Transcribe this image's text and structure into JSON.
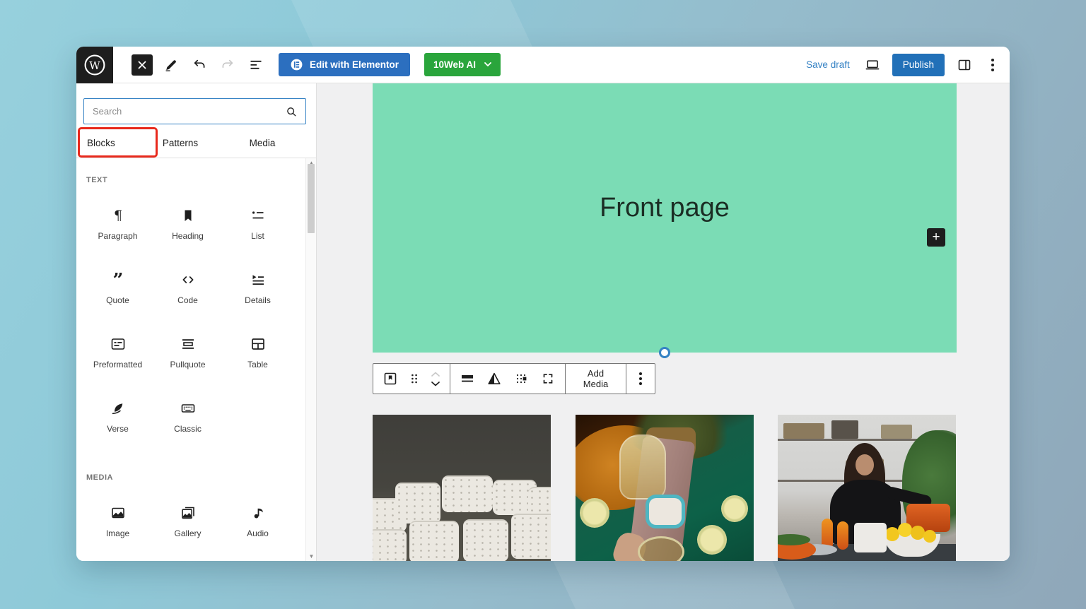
{
  "colors": {
    "cover_green": "#7bdcb5",
    "publish_blue": "#2170b8",
    "elementor_blue": "#2c6fbf",
    "tenweb_green": "#2aa53c",
    "annotation_red": "#e8291c",
    "canvas_gray": "#f0f0f1",
    "save_draft_blue": "#3582c4"
  },
  "header": {
    "edit_with_elementor_label": "Edit with Elementor",
    "tenweb_ai_label": "10Web AI",
    "save_draft_label": "Save draft",
    "publish_label": "Publish",
    "icons": [
      "wordpress-logo",
      "close-icon",
      "pencil-icon",
      "undo-icon",
      "redo-icon",
      "list-view-icon",
      "laptop-preview-icon",
      "settings-panel-icon",
      "kebab-menu-icon"
    ]
  },
  "inserter": {
    "search_placeholder": "Search",
    "tabs": [
      {
        "label": "Blocks",
        "highlighted": true
      },
      {
        "label": "Patterns",
        "highlighted": false
      },
      {
        "label": "Media",
        "highlighted": false
      }
    ],
    "sections": [
      {
        "title": "TEXT",
        "items": [
          {
            "label": "Paragraph",
            "icon": "paragraph-icon"
          },
          {
            "label": "Heading",
            "icon": "heading-icon"
          },
          {
            "label": "List",
            "icon": "list-icon"
          },
          {
            "label": "Quote",
            "icon": "quote-icon"
          },
          {
            "label": "Code",
            "icon": "code-icon"
          },
          {
            "label": "Details",
            "icon": "details-icon"
          },
          {
            "label": "Preformatted",
            "icon": "preformatted-icon"
          },
          {
            "label": "Pullquote",
            "icon": "pullquote-icon"
          },
          {
            "label": "Table",
            "icon": "table-icon"
          },
          {
            "label": "Verse",
            "icon": "verse-icon"
          },
          {
            "label": "Classic",
            "icon": "classic-icon"
          }
        ]
      },
      {
        "title": "MEDIA",
        "items": [
          {
            "label": "Image",
            "icon": "image-icon"
          },
          {
            "label": "Gallery",
            "icon": "gallery-icon"
          },
          {
            "label": "Audio",
            "icon": "audio-icon"
          }
        ]
      }
    ]
  },
  "canvas": {
    "cover_title": "Front page",
    "block_toolbar": {
      "add_media_label": "Add Media",
      "icons": [
        "cover-block-icon",
        "drag-handle-icon",
        "chevron-up-icon",
        "chevron-down-icon",
        "align-icon",
        "duotone-filter-icon",
        "content-position-icon",
        "full-height-icon",
        "kebab-menu-icon"
      ]
    },
    "gallery_photos": [
      "ceramic-mugs-on-dark-background",
      "overhead-drinks-table-with-limes",
      "woman-cooking-in-kitchen"
    ]
  }
}
